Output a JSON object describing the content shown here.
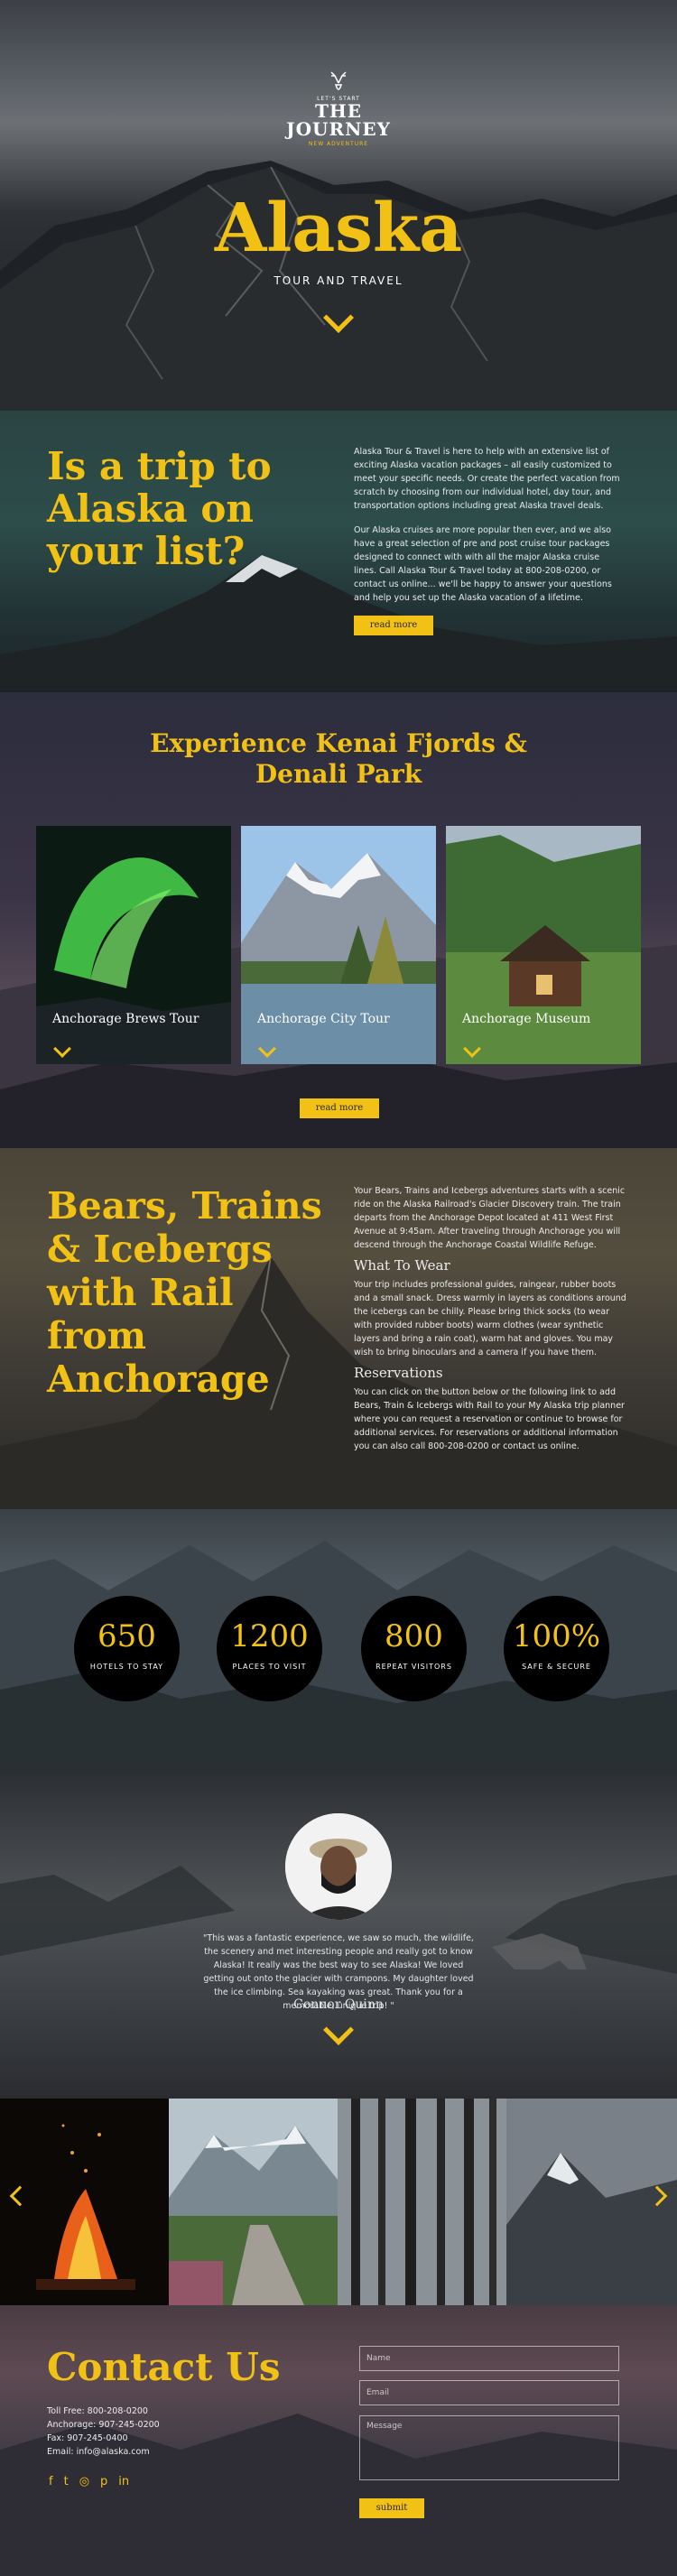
{
  "colors": {
    "accent": "#f2c115",
    "dark": "#1b1f24"
  },
  "hero": {
    "logo_small": "LET'S START",
    "logo_line1": "THE",
    "logo_line2": "JOURNEY",
    "logo_tag": "NEW ADVENTURE",
    "title": "Alaska",
    "subtitle": "TOUR AND TRAVEL",
    "scroll_icon": "chevron-down-icon"
  },
  "trip": {
    "title": "Is a trip to Alaska on your list?",
    "paragraph1": "Alaska Tour & Travel is here to help with an extensive list of exciting Alaska vacation packages – all easily customized to meet your specific needs. Or create the perfect vacation from scratch by choosing from our individual hotel, day tour, and transportation options including great Alaska travel deals.",
    "paragraph2": "Our Alaska cruises are more popular then ever, and we also have a great selection of pre and post cruise tour packages designed to connect with with all the major Alaska cruise lines. Call Alaska Tour & Travel today at 800-208-0200, or contact us online... we'll be happy to answer your questions and help you set up the Alaska vacation of a lifetime.",
    "button": "read more"
  },
  "kenai": {
    "title_line1": "Experience Kenai Fjords &",
    "title_line2": "Denali Park",
    "cards": [
      {
        "label": "Anchorage Brews Tour"
      },
      {
        "label": "Anchorage City Tour"
      },
      {
        "label": "Anchorage Museum"
      }
    ],
    "button": "read more"
  },
  "bears": {
    "title": "Bears, Trains & Icebergs with Rail from Anchorage",
    "intro": "Your Bears, Trains and Icebergs adventures starts with a scenic ride on the Alaska Railroad's Glacier Discovery train. The train departs from the Anchorage Depot located at 411 West First Avenue at 9:45am. After traveling through Anchorage you will descend through the Anchorage Coastal Wildlife Refuge.",
    "wear_heading": "What To Wear",
    "wear_text": "Your trip includes professional guides, raingear, rubber boots and a small snack. Dress warmly in layers as conditions around the icebergs can be chilly. Please bring thick socks (to wear with provided rubber boots) warm clothes (wear synthetic layers and bring a rain coat), warm hat and gloves. You may wish to bring binoculars and a camera if you have them.",
    "res_heading": "Reservations",
    "res_text": "You can click on the button below or the following link to add Bears, Train & Icebergs with Rail to your My Alaska trip planner where you can request a reservation or continue to browse for additional services. For reservations or additional information you can also call 800-208-0200 or contact us online."
  },
  "stats": [
    {
      "value": "650",
      "label": "HOTELS TO STAY"
    },
    {
      "value": "1200",
      "label": "PLACES TO VISIT"
    },
    {
      "value": "800",
      "label": "REPEAT VISITORS"
    },
    {
      "value": "100%",
      "label": "SAFE & SECURE"
    }
  ],
  "testimonial": {
    "quote": "\"This was a fantastic experience, we saw so much, the wildlife, the scenery and met interesting people and really got to know Alaska! It really was the best way to see Alaska! We loved getting out onto the glacier with crampons. My daughter loved the ice climbing. Sea kayaking was great. Thank you for a memorable, unique trip! \"",
    "author": "Connor Quinn"
  },
  "gallery": {
    "prev_icon": "chevron-left-icon",
    "next_icon": "chevron-right-icon"
  },
  "contact": {
    "title": "Contact Us",
    "toll_free": "Toll Free: 800-208-0200",
    "anchorage": "Anchorage: 907-245-0200",
    "fax": "Fax: 907-245-0400",
    "email": "Email: info@alaska.com",
    "social": [
      "f",
      "t",
      "◎",
      "p",
      "in"
    ],
    "name_placeholder": "Name",
    "email_placeholder": "Email",
    "message_placeholder": "Message",
    "submit": "submit"
  }
}
